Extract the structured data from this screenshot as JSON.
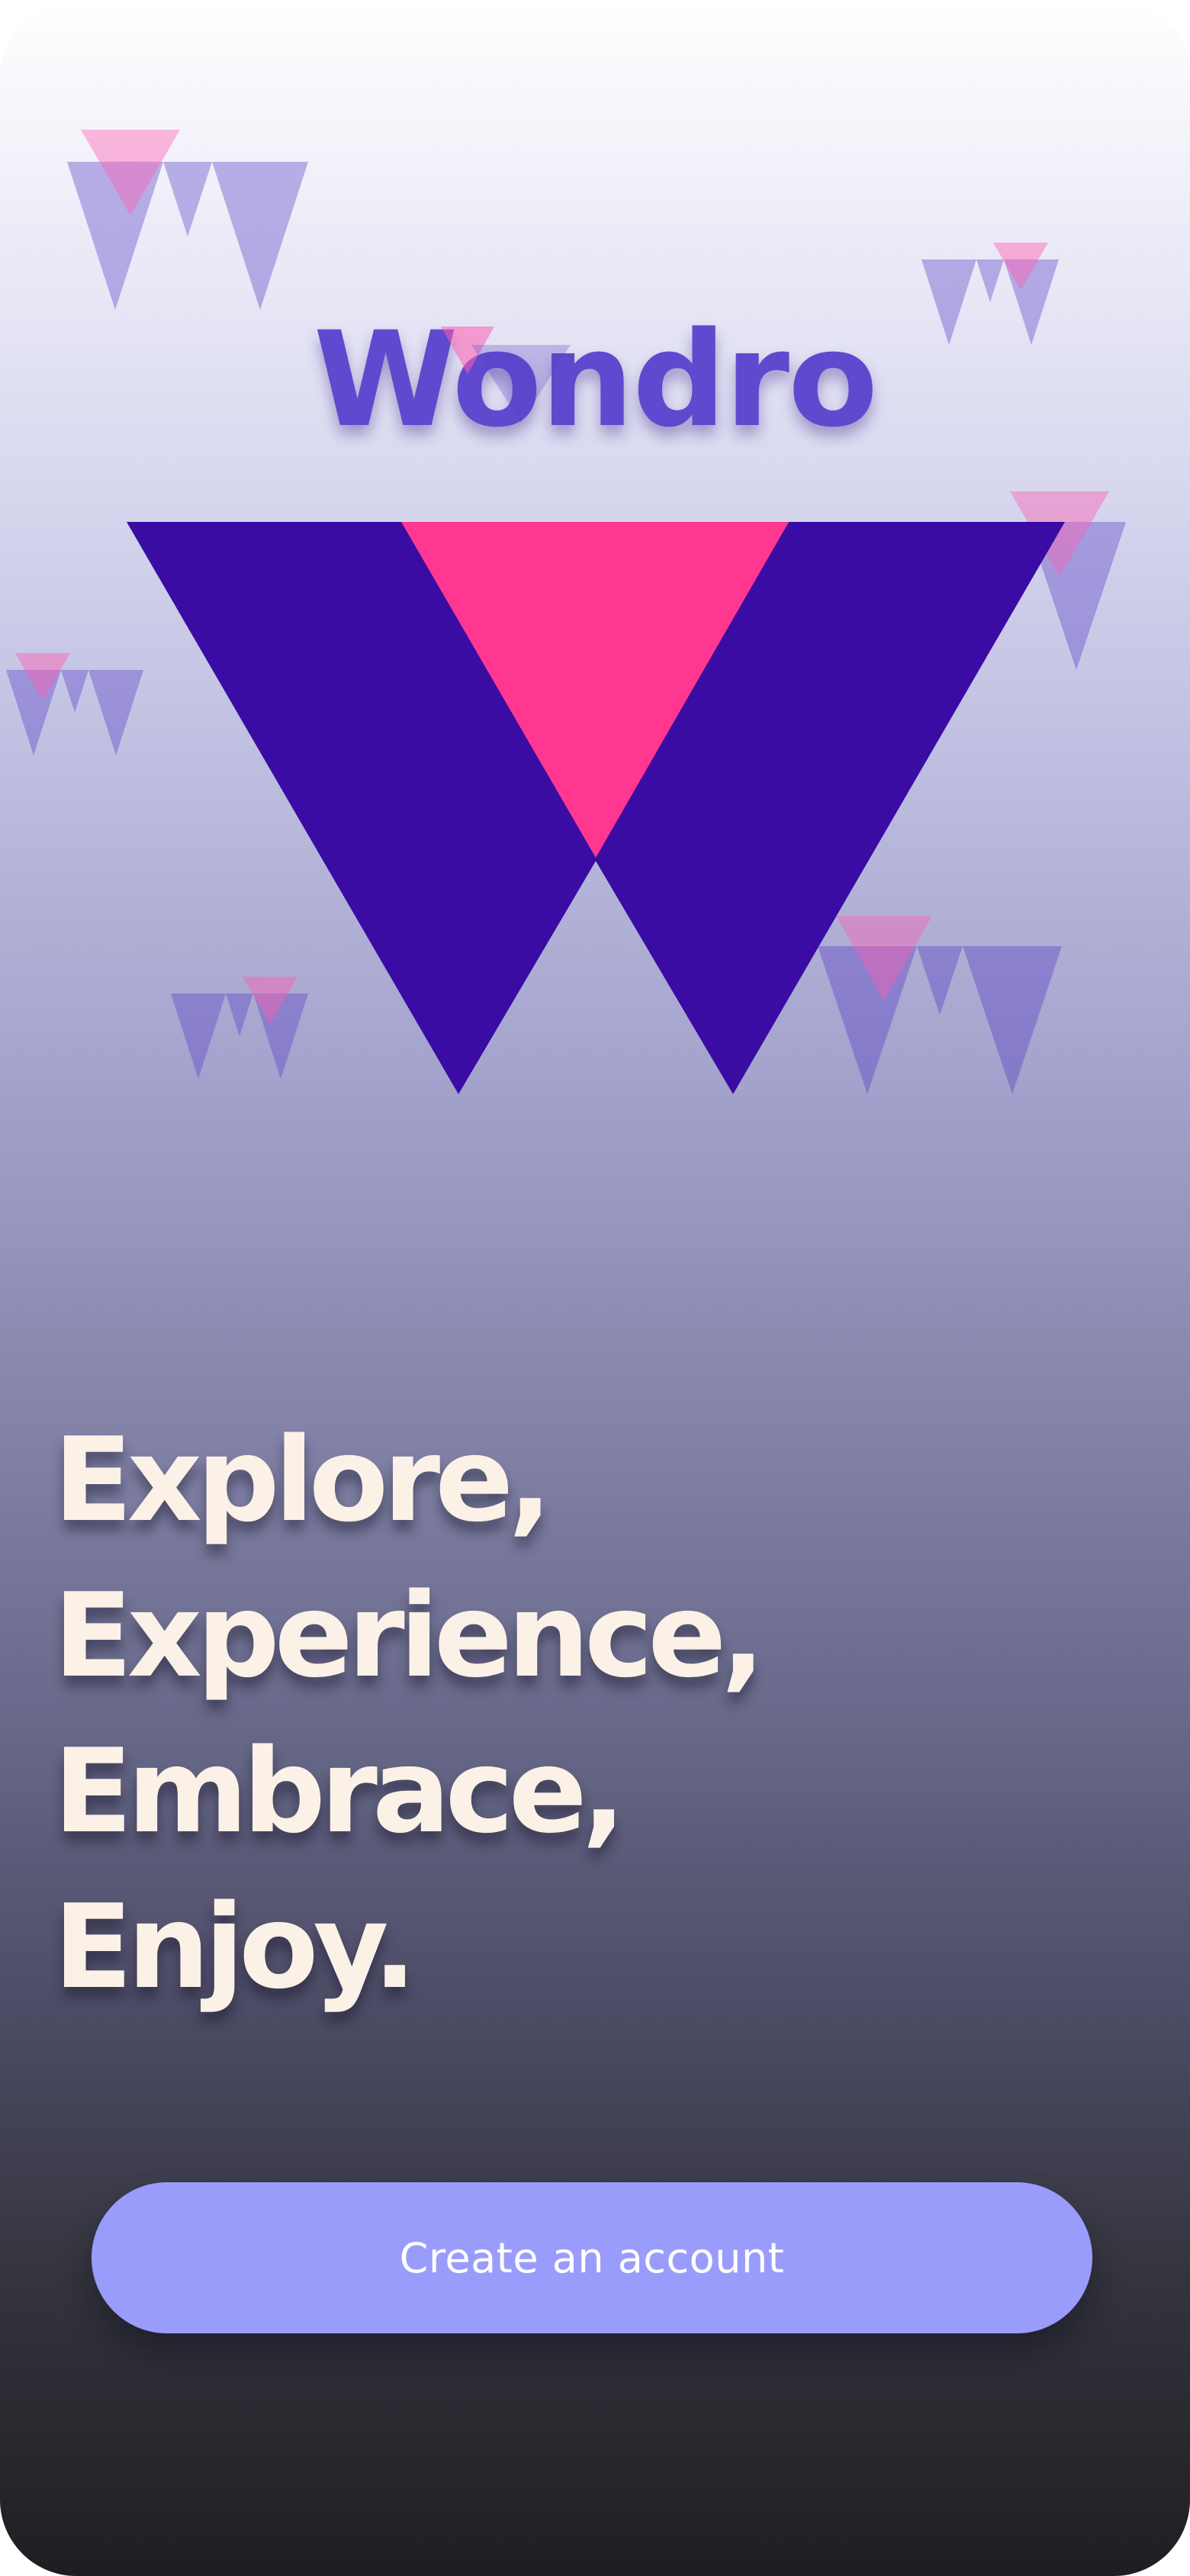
{
  "brand": {
    "name": "Wondro",
    "logo_icon": "w-logo-icon",
    "colors": {
      "primary": "#3a0ca3",
      "accent": "#ff3790",
      "wordmark": "#5f49cf"
    }
  },
  "headline": {
    "lines": [
      "Explore,",
      "Experience,",
      "Embrace,",
      "Enjoy."
    ],
    "color": "#fbf1e6"
  },
  "cta": {
    "label": "Create an account",
    "background": "#9a9cfc",
    "text_color": "#ffffff"
  },
  "background_gradient": {
    "top": "#ffffff",
    "bottom": "#1e1e22"
  }
}
